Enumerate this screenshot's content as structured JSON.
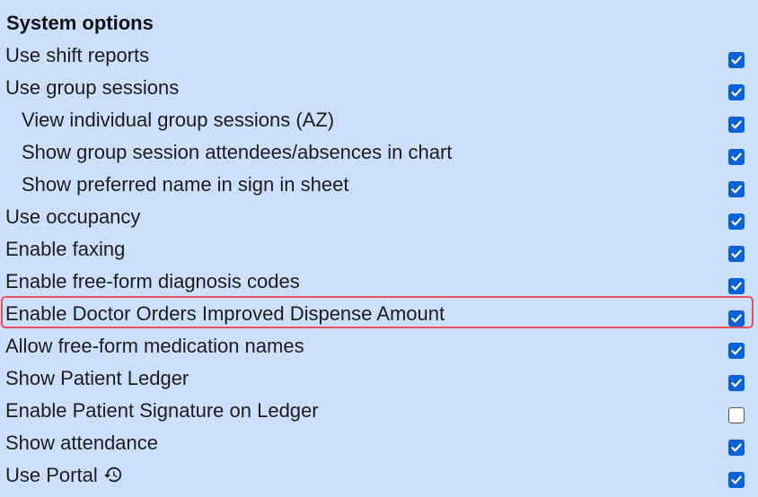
{
  "section": {
    "title": "System options"
  },
  "options": [
    {
      "label": "Use shift reports",
      "checked": true,
      "indent": false
    },
    {
      "label": "Use group sessions",
      "checked": true,
      "indent": false
    },
    {
      "label": "View individual group sessions (AZ)",
      "checked": true,
      "indent": true
    },
    {
      "label": "Show group session attendees/absences in chart",
      "checked": true,
      "indent": true
    },
    {
      "label": "Show preferred name in sign in sheet",
      "checked": true,
      "indent": true
    },
    {
      "label": "Use occupancy",
      "checked": true,
      "indent": false
    },
    {
      "label": "Enable faxing",
      "checked": true,
      "indent": false
    },
    {
      "label": "Enable free-form diagnosis codes",
      "checked": true,
      "indent": false
    },
    {
      "label": "Enable Doctor Orders Improved Dispense Amount",
      "checked": true,
      "indent": false,
      "highlighted": true
    },
    {
      "label": "Allow free-form medication names",
      "checked": true,
      "indent": false
    },
    {
      "label": "Show Patient Ledger",
      "checked": true,
      "indent": false
    },
    {
      "label": "Enable Patient Signature on Ledger",
      "checked": false,
      "indent": false
    },
    {
      "label": "Show attendance",
      "checked": true,
      "indent": false
    },
    {
      "label": "Use Portal",
      "checked": true,
      "indent": false,
      "icon": "history-icon"
    }
  ],
  "colors": {
    "background": "#cce0fe",
    "checkbox_checked": "#0a62d9",
    "highlight_border": "#e8505b"
  }
}
